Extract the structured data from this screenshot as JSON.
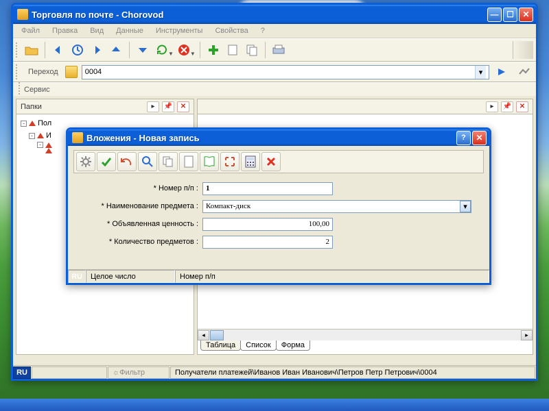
{
  "main_window": {
    "title": "Торговля по почте - Chorovod",
    "menu": [
      "Файл",
      "Правка",
      "Вид",
      "Данные",
      "Инструменты",
      "Свойства",
      "?"
    ],
    "nav": {
      "label": "Переход",
      "value": "0004"
    },
    "service_label": "Сервис",
    "left_panel": {
      "header": "Папки",
      "tree": [
        "Пол",
        "И"
      ]
    },
    "tabs": [
      "Таблица",
      "Список",
      "Форма"
    ],
    "status": {
      "lang": "RU",
      "filter": "Фильтр",
      "path": "Получатели платежей\\Иванов Иван Иванович\\Петров Петр Петрович\\0004"
    }
  },
  "dialog": {
    "title": "Вложения - Новая запись",
    "fields": {
      "seq": {
        "label": "* Номер п/п :",
        "value": "1"
      },
      "name": {
        "label": "* Наименование предмета :",
        "value": "Компакт-диск"
      },
      "declared": {
        "label": "* Объявленная ценность :",
        "value": "100,00"
      },
      "qty": {
        "label": "* Количество предметов :",
        "value": "2"
      }
    },
    "status": {
      "lang": "RU",
      "cell1": "Целое число",
      "cell2": "Номер п/п"
    }
  }
}
